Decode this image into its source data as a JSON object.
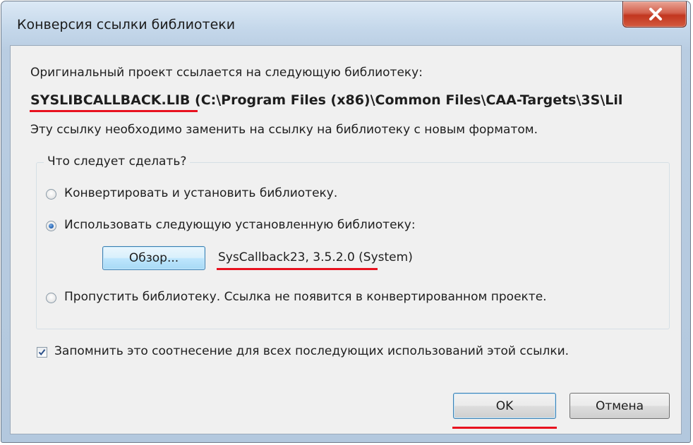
{
  "dialog": {
    "title": "Конверсия ссылки библиотеки",
    "intro": "Оригинальный проект ссылается на следующую библиотеку:",
    "library_name": "SYSLIBCALLBACK.LIB",
    "library_path": " (C:\\Program Files (x86)\\Common Files\\CAA-Targets\\3S\\Lil",
    "replace_note": "Эту ссылку необходимо заменить на ссылку на библиотеку с новым форматом.",
    "group": {
      "title": "Что следует сделать?",
      "options": [
        {
          "label": "Конвертировать и установить библиотеку.",
          "checked": false
        },
        {
          "label": "Использовать следующую установленную библиотеку:",
          "checked": true
        },
        {
          "label": "Пропустить библиотеку. Ссылка не появится в конвертированном проекте.",
          "checked": false
        }
      ],
      "browse_label": "Обзор...",
      "selected_library": "SysCallback23, 3.5.2.0",
      "selected_library_suffix": " (System)"
    },
    "remember": {
      "label": "Запомнить это соотнесение для всех последующих использований этой ссылки.",
      "checked": true
    },
    "ok_label": "OK",
    "cancel_label": "Отмена",
    "close_icon": "close-icon",
    "highlight_color": "#e8121f",
    "close_color": "#c2361f"
  }
}
